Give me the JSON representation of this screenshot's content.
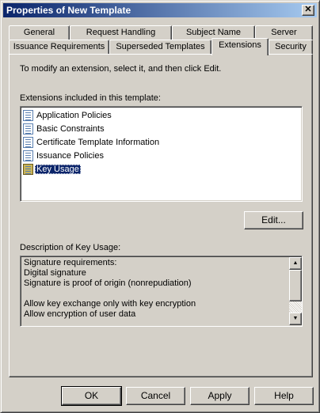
{
  "window": {
    "title": "Properties of New Template"
  },
  "tabs_back_row": [
    "General",
    "Request Handling",
    "Subject Name",
    "Server"
  ],
  "tabs_front_row": [
    "Issuance Requirements",
    "Superseded Templates",
    "Extensions",
    "Security"
  ],
  "active_tab": "Extensions",
  "instruction": "To modify an extension, select it, and then click Edit.",
  "extensions": {
    "label": "Extensions included in this template:",
    "items": [
      {
        "label": "Application Policies",
        "icon": "extension-icon",
        "selected": false
      },
      {
        "label": "Basic Constraints",
        "icon": "extension-icon",
        "selected": false
      },
      {
        "label": "Certificate Template Information",
        "icon": "extension-icon",
        "selected": false
      },
      {
        "label": "Issuance Policies",
        "icon": "extension-icon",
        "selected": false
      },
      {
        "label": "Key Usage",
        "icon": "critical-extension-icon",
        "selected": true
      }
    ]
  },
  "edit_button": "Edit...",
  "description": {
    "label": "Description of Key Usage:",
    "lines": [
      "Signature requirements:",
      "Digital signature",
      "Signature is proof of origin (nonrepudiation)",
      "",
      "Allow key exchange only with key encryption",
      "Allow encryption of user data"
    ]
  },
  "footer_buttons": {
    "ok": "OK",
    "cancel": "Cancel",
    "apply": "Apply",
    "help": "Help"
  },
  "colors": {
    "titlebar_start": "#0a246a",
    "titlebar_end": "#a6caf0",
    "dialog_face": "#d4d0c8",
    "selection": "#0a246a"
  }
}
